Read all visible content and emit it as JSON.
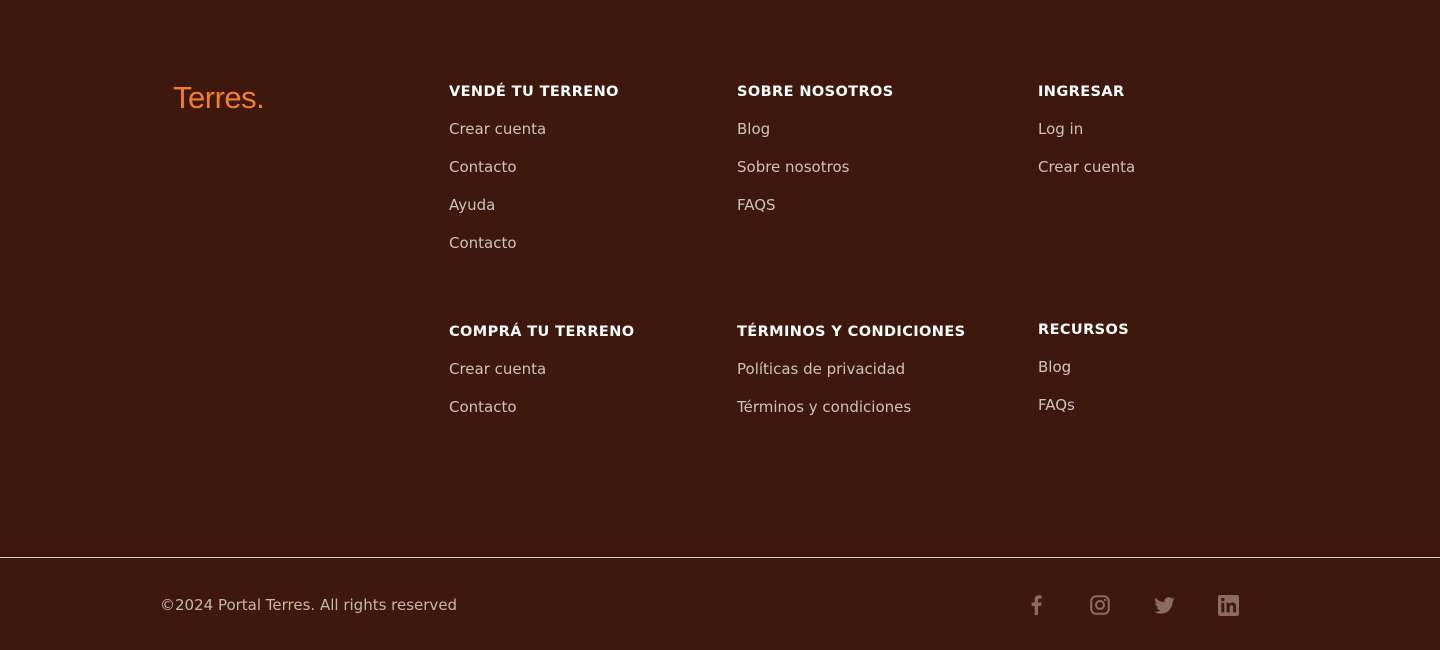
{
  "brand": {
    "logo_text": "Terres."
  },
  "columns": [
    {
      "title": "VENDÉ TU TERRENO",
      "links": [
        "Crear cuenta",
        "Contacto",
        "Ayuda",
        "Contacto"
      ]
    },
    {
      "title": "SOBRE NOSOTROS",
      "links": [
        "Blog",
        "Sobre nosotros",
        "FAQS"
      ]
    },
    {
      "title": "INGRESAR",
      "links": [
        "Log in",
        "Crear cuenta"
      ]
    },
    {
      "title": "COMPRÁ TU TERRENO",
      "links": [
        "Crear cuenta",
        "Contacto"
      ]
    },
    {
      "title": "TÉRMINOS Y CONDICIONES",
      "links": [
        "Políticas de privacidad",
        "Términos y condiciones"
      ]
    },
    {
      "title": "RECURSOS",
      "links": [
        "Blog",
        "FAQs"
      ]
    }
  ],
  "bottom_bar": {
    "copyright": "©2024 Portal Terres. All rights reserved",
    "social_icons": [
      "facebook-icon",
      "instagram-icon",
      "twitter-icon",
      "linkedin-icon"
    ]
  },
  "colors": {
    "background": "#3e180d",
    "accent": "#f07f2c",
    "heading": "#ffffff",
    "link": "#cfc1b7",
    "icon": "#8a6c61"
  }
}
